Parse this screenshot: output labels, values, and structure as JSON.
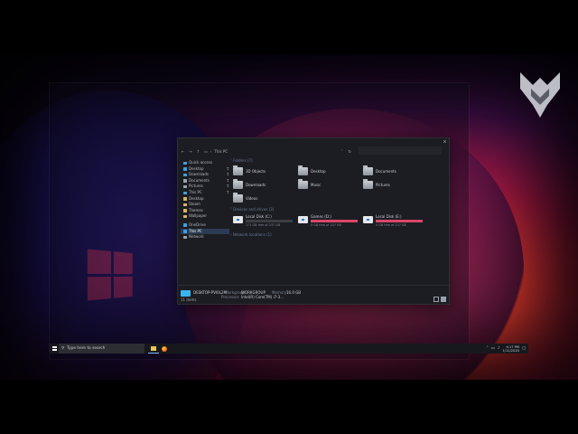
{
  "window": {
    "breadcrumb": "This PC",
    "sections": {
      "folders": "Folders (7)",
      "drives": "Devices and drives (3)",
      "network": "Network locations (1)"
    }
  },
  "sidebar": {
    "items": [
      {
        "label": "Quick access",
        "icon": "star-icon",
        "pinned": false
      },
      {
        "label": "Desktop",
        "icon": "folder-icon",
        "pinned": true
      },
      {
        "label": "Downloads",
        "icon": "folder-icon",
        "pinned": true
      },
      {
        "label": "Documents",
        "icon": "folder-icon",
        "pinned": true
      },
      {
        "label": "Pictures",
        "icon": "folder-icon",
        "pinned": true
      },
      {
        "label": "This PC",
        "icon": "pc-icon",
        "pinned": true
      },
      {
        "label": "Desktop",
        "icon": "folder-icon",
        "pinned": false
      },
      {
        "label": "Steam",
        "icon": "folder-icon",
        "pinned": false
      },
      {
        "label": "Themes",
        "icon": "folder-icon",
        "pinned": false
      },
      {
        "label": "Wallpaper",
        "icon": "folder-icon",
        "pinned": false
      },
      {
        "label": "OneDrive",
        "icon": "cloud-icon",
        "pinned": false
      },
      {
        "label": "This PC",
        "icon": "pc-icon",
        "pinned": false,
        "selected": true
      },
      {
        "label": "Network",
        "icon": "network-icon",
        "pinned": false
      }
    ]
  },
  "folders": [
    "3D Objects",
    "Desktop",
    "Documents",
    "Downloads",
    "Music",
    "Pictures",
    "Videos"
  ],
  "drives": [
    {
      "name": "Local Disk (C:)",
      "free": "171 GB free of 237 GB",
      "used_fraction": 0.28,
      "color": "#3a3d44"
    },
    {
      "name": "Games (D:)",
      "free": "0 GB free of 237 GB",
      "used_fraction": 1.0,
      "color": "#d9466a"
    },
    {
      "name": "Local Disk (E:)",
      "free": "0 GB free of 237 GB",
      "used_fraction": 1.0,
      "color": "#d9466a"
    }
  ],
  "details": {
    "name": "DESKTOP-PVI0L2M",
    "workgroup_label": "Workgroup:",
    "workgroup": "WORKGROUP",
    "memory_label": "Memory:",
    "memory": "16.0 GB",
    "processor_label": "Processor:",
    "processor": "Intel(R) Core(TM) i7-3..."
  },
  "status": "11 items",
  "taskbar": {
    "search_placeholder": "Type here to search",
    "time": "4:17 PM",
    "date": "1/11/2020"
  }
}
